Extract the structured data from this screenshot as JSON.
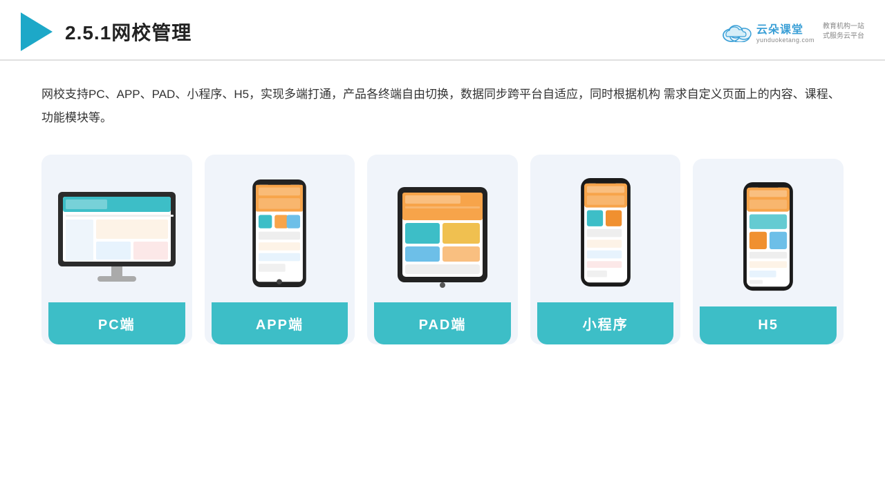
{
  "header": {
    "title": "2.5.1网校管理",
    "brand": {
      "name": "云朵课堂",
      "url": "yunduoketang.com",
      "slogan": "教育机构一站\n式服务云平台"
    }
  },
  "description": "网校支持PC、APP、PAD、小程序、H5，实现多端打通，产品各终端自由切换，数据同步跨平台自适应，同时根据机构\n需求自定义页面上的内容、课程、功能模块等。",
  "cards": [
    {
      "id": "pc",
      "label": "PC端"
    },
    {
      "id": "app",
      "label": "APP端"
    },
    {
      "id": "pad",
      "label": "PAD端"
    },
    {
      "id": "miniprogram",
      "label": "小程序"
    },
    {
      "id": "h5",
      "label": "H5"
    }
  ],
  "accent_color": "#3dbec7"
}
